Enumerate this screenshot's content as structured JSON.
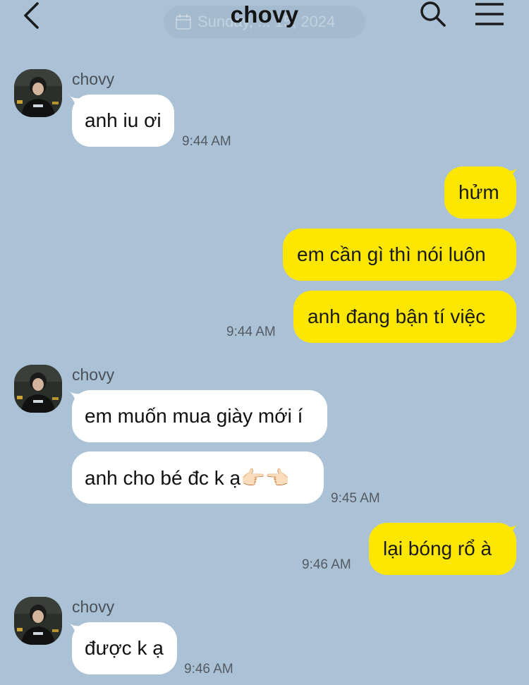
{
  "header": {
    "title": "chovy",
    "date_label": "Sunday, ... 15, 2024",
    "icons": {
      "back": "chevron-left-icon",
      "search": "search-icon",
      "menu": "hamburger-menu-icon",
      "calendar": "calendar-icon"
    }
  },
  "colors": {
    "background": "#abc1d6",
    "incoming_bubble": "#ffffff",
    "outgoing_bubble": "#fde700"
  },
  "messages": {
    "group1": {
      "sender": "chovy",
      "bubbles": [
        "anh iu ơi"
      ],
      "time": "9:44 AM"
    },
    "group2": {
      "bubbles": [
        "hửm",
        "em cần gì thì nói luôn",
        "anh đang bận tí việc"
      ],
      "time": "9:44 AM"
    },
    "group3": {
      "sender": "chovy",
      "bubbles": [
        "em muốn mua giày mới í",
        "anh cho bé đc k ạ👉🏻👈🏻"
      ],
      "time": "9:45 AM"
    },
    "group4": {
      "bubbles": [
        "lại bóng rổ à"
      ],
      "time": "9:46 AM"
    },
    "group5": {
      "sender": "chovy",
      "bubbles": [
        "được k ạ"
      ],
      "time": "9:46 AM"
    }
  }
}
